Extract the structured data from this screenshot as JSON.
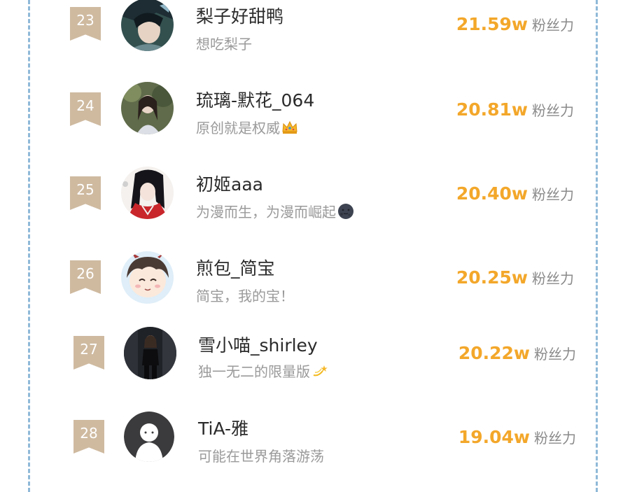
{
  "ranking": {
    "unit_label": "粉丝力",
    "entries": [
      {
        "rank": "23",
        "name": "梨子好甜鸭",
        "bio": "想吃梨子",
        "bio_emoji": "",
        "fans": "21.59w",
        "avatar_icon": "anime-boy-avatar-icon"
      },
      {
        "rank": "24",
        "name": "琉璃-默花_064",
        "bio": "原创就是权威",
        "bio_emoji": "crown-emoji-icon",
        "fans": "20.81w",
        "avatar_icon": "girl-photo-avatar-icon"
      },
      {
        "rank": "25",
        "name": "初姬aaa",
        "bio": "为漫而生，为漫而崛起",
        "bio_emoji": "new-moon-face-emoji-icon",
        "fans": "20.40w",
        "avatar_icon": "anime-girl-avatar-icon"
      },
      {
        "rank": "26",
        "name": "煎包_简宝",
        "bio": "简宝，我的宝！",
        "bio_emoji": "",
        "fans": "20.25w",
        "avatar_icon": "chibi-boy-avatar-icon"
      },
      {
        "rank": "27",
        "name": "雪小喵_shirley",
        "bio": "独一无二的限量版",
        "bio_emoji": "dizzy-emoji-icon",
        "fans": "20.22w",
        "avatar_icon": "woman-photo-avatar-icon"
      },
      {
        "rank": "28",
        "name": "TiA-雅",
        "bio": "可能在世界角落游荡",
        "bio_emoji": "",
        "fans": "19.04w",
        "avatar_icon": "default-user-avatar-icon"
      }
    ]
  },
  "colors": {
    "rank_badge": "#cfbaa0",
    "fans_value": "#f3a72a",
    "frame_dash": "#8fb9d8"
  }
}
